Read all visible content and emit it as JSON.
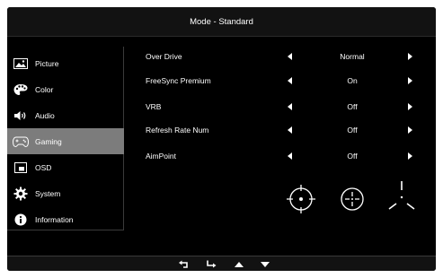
{
  "header": {
    "title": "Mode - Standard"
  },
  "sidebar": {
    "items": [
      {
        "label": "Picture",
        "icon": "picture-icon",
        "active": false
      },
      {
        "label": "Color",
        "icon": "palette-icon",
        "active": false
      },
      {
        "label": "Audio",
        "icon": "speaker-icon",
        "active": false
      },
      {
        "label": "Gaming",
        "icon": "gamepad-icon",
        "active": true
      },
      {
        "label": "OSD",
        "icon": "osd-window-icon",
        "active": false
      },
      {
        "label": "System",
        "icon": "gear-icon",
        "active": false
      },
      {
        "label": "Information",
        "icon": "info-icon",
        "active": false
      }
    ]
  },
  "settings": [
    {
      "label": "Over Drive",
      "value": "Normal"
    },
    {
      "label": "FreeSync Premium",
      "value": "On"
    },
    {
      "label": "VRB",
      "value": "Off"
    },
    {
      "label": "Refresh Rate Num",
      "value": "Off"
    },
    {
      "label": "AimPoint",
      "value": "Off"
    }
  ],
  "aimpoint_options": [
    "crosshair-circle-dot-icon",
    "crosshair-circle-gap-icon",
    "crosshair-tri-lines-icon"
  ],
  "footer": {
    "buttons": [
      "back-icon",
      "enter-icon",
      "up-arrow-icon",
      "down-arrow-icon"
    ]
  },
  "colors": {
    "background": "#000000",
    "highlight": "#7c7c7c",
    "text": "#ffffff"
  }
}
